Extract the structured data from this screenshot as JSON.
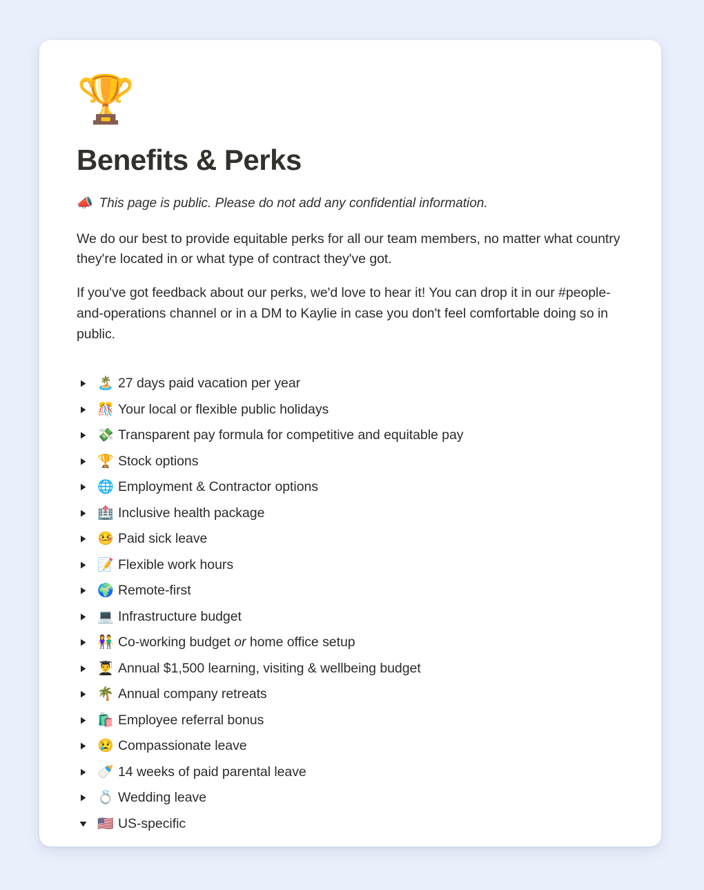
{
  "page": {
    "background_color": "#e9effb",
    "card_background": "#ffffff",
    "title": "Benefits & Perks",
    "icon": "🏆",
    "icon_name": "trophy-emoji",
    "title_color": "#33312c"
  },
  "notice": {
    "emoji": "📣",
    "emoji_name": "megaphone-emoji",
    "text": "This page is public. Please do not add any confidential information."
  },
  "paragraphs": [
    "We do our best to provide equitable perks for all our team members, no matter what country they're located in or what type of contract they've got.",
    "If you've got feedback about our perks, we'd love to hear it! You can drop it in our #people-and-operations channel or in a DM to Kaylie in case you don't feel comfortable doing so in public."
  ],
  "toggle_list": [
    {
      "emoji": "🏝️",
      "emoji_name": "desert-island-emoji",
      "label": "27 days paid vacation per year",
      "expanded": false
    },
    {
      "emoji": "🎊",
      "emoji_name": "confetti-ball-emoji",
      "label": "Your local or flexible public holidays",
      "expanded": false
    },
    {
      "emoji": "💸",
      "emoji_name": "money-with-wings-emoji",
      "label": "Transparent pay formula for competitive and equitable pay",
      "expanded": false
    },
    {
      "emoji": "🏆",
      "emoji_name": "trophy-emoji",
      "label": "Stock options",
      "expanded": false
    },
    {
      "emoji": "🌐",
      "emoji_name": "globe-meridians-emoji",
      "label": "Employment & Contractor options",
      "expanded": false
    },
    {
      "emoji": "🏥",
      "emoji_name": "hospital-emoji",
      "label": "Inclusive health package",
      "expanded": false
    },
    {
      "emoji": "🤒",
      "emoji_name": "face-with-thermometer-emoji",
      "label": "Paid sick leave",
      "expanded": false
    },
    {
      "emoji": "📝",
      "emoji_name": "memo-emoji",
      "label": "Flexible work hours",
      "expanded": false
    },
    {
      "emoji": "🌍",
      "emoji_name": "earth-globe-emoji",
      "label": "Remote-first",
      "expanded": false
    },
    {
      "emoji": "💻",
      "emoji_name": "laptop-emoji",
      "label": "Infrastructure budget",
      "expanded": false
    },
    {
      "emoji": "👫",
      "emoji_name": "people-holding-hands-emoji",
      "label": "Co-working budget or home office setup",
      "label_html": "Co-working budget <em>or</em> home office setup",
      "expanded": false
    },
    {
      "emoji": "👨‍🎓",
      "emoji_name": "graduate-emoji",
      "label": "Annual $1,500 learning, visiting & wellbeing budget",
      "expanded": false
    },
    {
      "emoji": "🌴",
      "emoji_name": "palm-tree-emoji",
      "label": "Annual company retreats",
      "expanded": false
    },
    {
      "emoji": "🛍️",
      "emoji_name": "shopping-bags-emoji",
      "label": "Employee referral bonus",
      "expanded": false
    },
    {
      "emoji": "😢",
      "emoji_name": "crying-face-emoji",
      "label": "Compassionate leave",
      "expanded": false
    },
    {
      "emoji": "🍼",
      "emoji_name": "baby-bottle-emoji",
      "label": "14 weeks of paid parental leave",
      "expanded": false
    },
    {
      "emoji": "💍",
      "emoji_name": "ring-emoji",
      "label": "Wedding leave",
      "expanded": false
    },
    {
      "emoji": "🇺🇸",
      "emoji_name": "us-flag-emoji",
      "label": "US-specific",
      "expanded": true
    }
  ]
}
